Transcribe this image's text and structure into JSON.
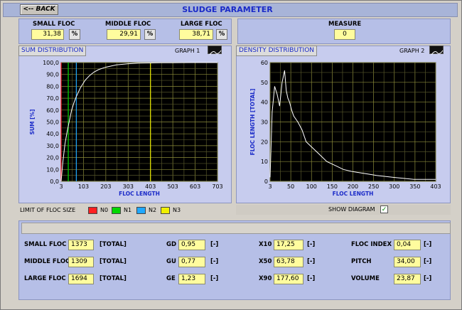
{
  "window": {
    "title": "SLUDGE PARAMETER",
    "back_label": "<-- BACK"
  },
  "summary": {
    "small_floc": {
      "label": "SMALL FLOC",
      "value": "31,38",
      "unit": "%"
    },
    "middle_floc": {
      "label": "MIDDLE FLOC",
      "value": "29,91",
      "unit": "%"
    },
    "large_floc": {
      "label": "LARGE FLOC",
      "value": "38,71",
      "unit": "%"
    },
    "measure": {
      "label": "MEASURE",
      "value": "0"
    }
  },
  "graph1": {
    "tab_label": "SUM DISTRIBUTION",
    "graph_button": "GRAPH 1",
    "chart_data": {
      "type": "line",
      "xlabel": "FLOC LENGTH",
      "ylabel": "SUM [%]",
      "xlim": [
        3,
        703
      ],
      "ylim": [
        0,
        100
      ],
      "x_ticks": [
        "3",
        "103",
        "203",
        "303",
        "403",
        "503",
        "603",
        "703"
      ],
      "y_ticks": [
        "0,0",
        "10,0",
        "20,0",
        "30,0",
        "40,0",
        "50,0",
        "60,0",
        "70,0",
        "80,0",
        "90,0",
        "100,0"
      ],
      "series": [
        {
          "x": [
            3,
            10,
            20,
            30,
            40,
            50,
            60,
            70,
            80,
            90,
            100,
            110,
            120,
            130,
            150,
            170,
            200,
            250,
            300,
            350,
            403,
            450,
            500,
            600,
            703
          ],
          "y": [
            0,
            15,
            31,
            42,
            51,
            60,
            66,
            71,
            75,
            79,
            82,
            85,
            87,
            89,
            92,
            94,
            96,
            98,
            99,
            99.5,
            99.7,
            99.8,
            99.9,
            100,
            100
          ]
        }
      ],
      "limit_markers_x": [
        3,
        35,
        71,
        403
      ],
      "limit_colors": [
        "#ff2020",
        "#00d800",
        "#20a8ff",
        "#f0f000"
      ]
    }
  },
  "graph2": {
    "tab_label": "DENSITY DISTRIBUTION",
    "graph_button": "GRAPH 2",
    "chart_data": {
      "type": "line",
      "xlabel": "FLOC LENGTH",
      "ylabel": "FLOC LENGTH [TOTAL]",
      "xlim": [
        3,
        403
      ],
      "ylim": [
        0,
        60
      ],
      "x_ticks": [
        "3",
        "50",
        "100",
        "150",
        "200",
        "250",
        "300",
        "350",
        "403"
      ],
      "y_ticks": [
        "0",
        "10",
        "20",
        "30",
        "40",
        "50",
        "60"
      ],
      "series": [
        {
          "x": [
            3,
            8,
            14,
            20,
            26,
            32,
            38,
            42,
            46,
            50,
            55,
            60,
            70,
            80,
            90,
            100,
            120,
            140,
            160,
            180,
            200,
            230,
            260,
            300,
            350,
            403
          ],
          "y": [
            2,
            35,
            48,
            44,
            38,
            50,
            56,
            46,
            42,
            40,
            36,
            33,
            30,
            26,
            20,
            18,
            14,
            10,
            8,
            6,
            5,
            4,
            3,
            2,
            1,
            1
          ]
        }
      ]
    },
    "show_diagram_label": "SHOW DIAGRAM",
    "show_diagram_checked": true
  },
  "limits": {
    "label": "LIMIT OF FLOC SIZE",
    "items": [
      {
        "label": "N0",
        "color": "#ff2020"
      },
      {
        "label": "N1",
        "color": "#00d800"
      },
      {
        "label": "N2",
        "color": "#20a8ff"
      },
      {
        "label": "N3",
        "color": "#f0f000"
      }
    ]
  },
  "results": {
    "col1": [
      {
        "label": "SMALL FLOC",
        "value": "1373",
        "unit": "[TOTAL]"
      },
      {
        "label": "MIDDLE FLOC",
        "value": "1309",
        "unit": "[TOTAL]"
      },
      {
        "label": "LARGE FLOC",
        "value": "1694",
        "unit": "[TOTAL]"
      }
    ],
    "col2": [
      {
        "label": "GD",
        "value": "0,95",
        "unit": "[-]"
      },
      {
        "label": "GU",
        "value": "0,77",
        "unit": "[-]"
      },
      {
        "label": "GE",
        "value": "1,23",
        "unit": "[-]"
      }
    ],
    "col3": [
      {
        "label": "X10",
        "value": "17,25",
        "unit": "[-]"
      },
      {
        "label": "X50",
        "value": "63,78",
        "unit": "[-]"
      },
      {
        "label": "X90",
        "value": "177,60",
        "unit": "[-]"
      }
    ],
    "col4": [
      {
        "label": "FLOC INDEX",
        "value": "0,04",
        "unit": "[-]"
      },
      {
        "label": "PITCH",
        "value": "34,00",
        "unit": "[-]"
      },
      {
        "label": "VOLUME",
        "value": "23,87",
        "unit": "[-]"
      }
    ]
  }
}
